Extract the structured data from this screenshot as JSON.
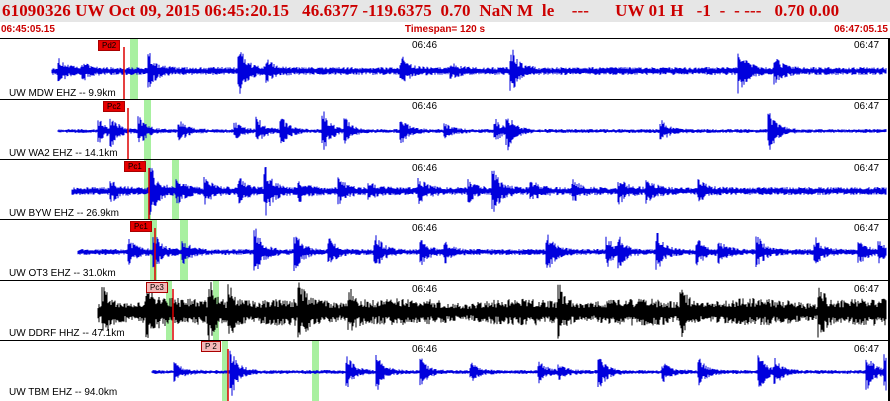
{
  "header": {
    "title": "61090326 UW Oct 09, 2015 06:45:20.15   46.6377 -119.6375  0.70  NaN M  le    ---      UW 01 H   -1  -  - ---   0.70 0.00"
  },
  "time_bar": {
    "start": "06:45:05.15",
    "timespan": "Timespan= 120 s",
    "end": "06:47:05.15"
  },
  "traces": [
    {
      "label": "UW MDW EHZ -- 9.9km",
      "pick": "Pd2",
      "pick_style": "auto",
      "mark_mid": "06:46",
      "mark_end": "06:47",
      "color": "#0000dd"
    },
    {
      "label": "UW WA2 EHZ -- 14.1km",
      "pick": "Pc2",
      "pick_style": "auto",
      "mark_mid": "06:46",
      "mark_end": "06:47",
      "color": "#0000dd"
    },
    {
      "label": "UW BYW EHZ -- 26.9km",
      "pick": "Pc1",
      "pick_style": "auto",
      "mark_mid": "06:46",
      "mark_end": "06:47",
      "color": "#0000dd"
    },
    {
      "label": "UW OT3 EHZ -- 31.0km",
      "pick": "Pc1",
      "pick_style": "auto",
      "mark_mid": "06:46",
      "mark_end": "06:47",
      "color": "#0000dd"
    },
    {
      "label": "UW DDRF HHZ -- 47.1km",
      "pick": "Pc3",
      "pick_style": "man",
      "mark_mid": "06:46",
      "mark_end": "06:47",
      "color": "#000000"
    },
    {
      "label": "UW TBM EHZ -- 94.0km",
      "pick": "P 2",
      "pick_style": "man",
      "mark_mid": "06:46",
      "mark_end": "06:47",
      "color": "#0000dd"
    }
  ]
}
